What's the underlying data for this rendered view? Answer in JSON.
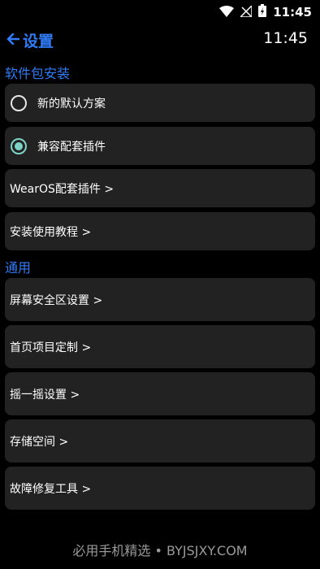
{
  "status_bar": {
    "time": "11:45",
    "icons": [
      "wifi-icon",
      "no-signal-icon",
      "battery-charging-icon"
    ]
  },
  "header": {
    "back_icon": "arrow-left-icon",
    "title": "设置",
    "clock": "11:45"
  },
  "sections": {
    "package": {
      "title": "软件包安装",
      "options": [
        {
          "label": "新的默认方案",
          "selected": false
        },
        {
          "label": "兼容配套插件",
          "selected": true
        }
      ],
      "links": [
        {
          "label": "WearOS配套插件 >"
        },
        {
          "label": "安装使用教程 >"
        }
      ]
    },
    "general": {
      "title": "通用",
      "links": [
        {
          "label": "屏幕安全区设置 >"
        },
        {
          "label": "首页项目定制 >"
        },
        {
          "label": "摇一摇设置 >"
        },
        {
          "label": "存储空间 >"
        },
        {
          "label": "故障修复工具 >"
        }
      ]
    }
  },
  "watermark": "必用手机精选 • BYJSJXY.COM",
  "colors": {
    "accent": "#2f7cf6",
    "radio_checked": "#7fd3c6",
    "card_bg": "#222222"
  }
}
